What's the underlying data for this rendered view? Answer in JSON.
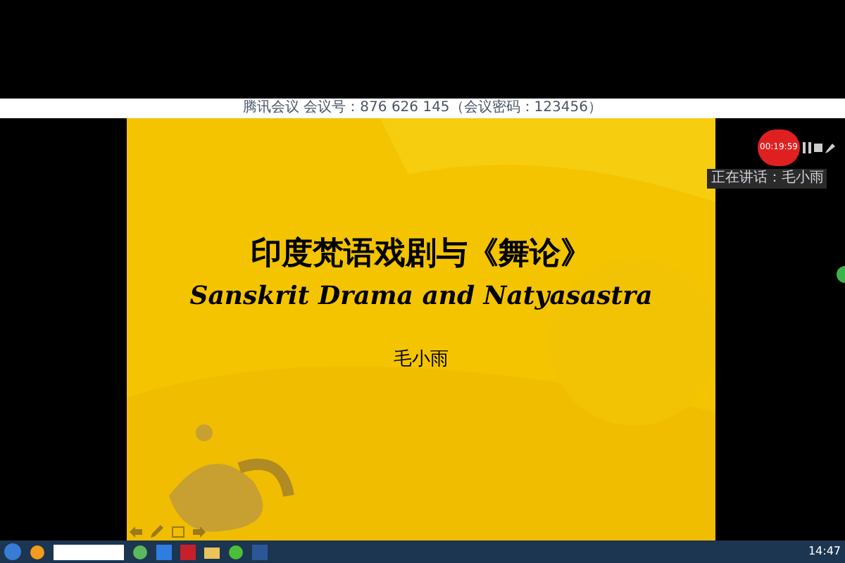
{
  "window": {
    "title": "腾讯会议 会议号：876 626 145（会议密码：123456）"
  },
  "slide": {
    "title": "印度梵语戏剧与《舞论》",
    "subtitle": "Sanskrit Drama and Natyasastra",
    "author": "毛小雨"
  },
  "recorder": {
    "timer": "00:19:59"
  },
  "speaker": {
    "label": "正在讲话：毛小雨"
  },
  "taskbar": {
    "clock": "14:47"
  }
}
